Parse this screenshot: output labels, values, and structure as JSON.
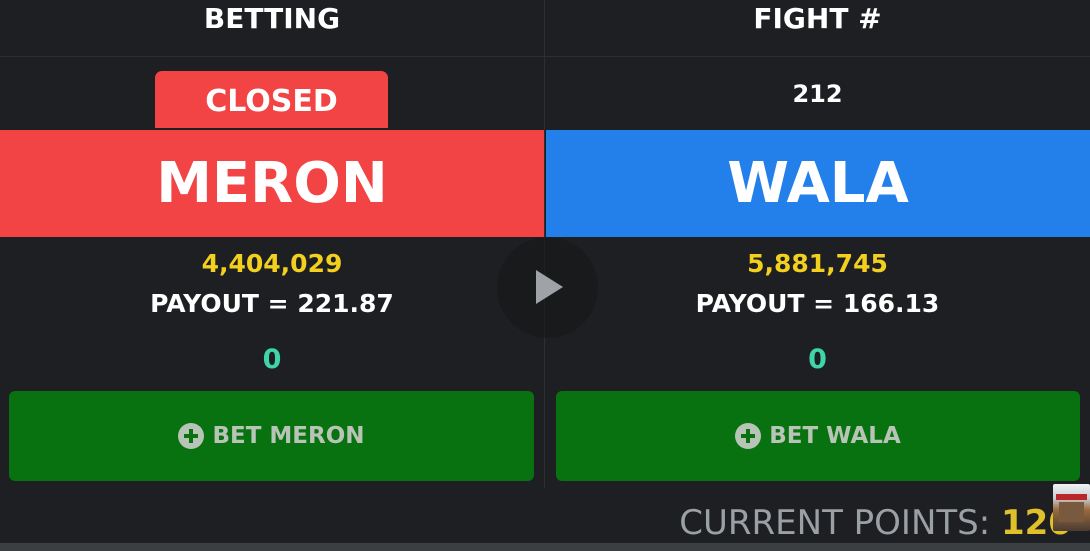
{
  "header": {
    "betting_label": "BETTING",
    "fight_label": "FIGHT #"
  },
  "status": {
    "betting_status": "CLOSED",
    "fight_number": "212"
  },
  "meron": {
    "name": "MERON",
    "total": "4,404,029",
    "payout": "PAYOUT = 221.87",
    "my_bet": "0",
    "button_label": "BET MERON",
    "color": "#f24444"
  },
  "wala": {
    "name": "WALA",
    "total": "5,881,745",
    "payout": "PAYOUT = 166.13",
    "my_bet": "0",
    "button_label": "BET WALA",
    "color": "#2380ea"
  },
  "footer": {
    "points_label": "CURRENT POINTS: ",
    "points_value": "120"
  },
  "icons": {
    "bet_icon": "plus-circle-icon",
    "play_icon": "play-icon"
  },
  "colors": {
    "total_text": "#f2d01d",
    "my_bet_text": "#3ed6a8",
    "bet_button": "#07720f"
  }
}
